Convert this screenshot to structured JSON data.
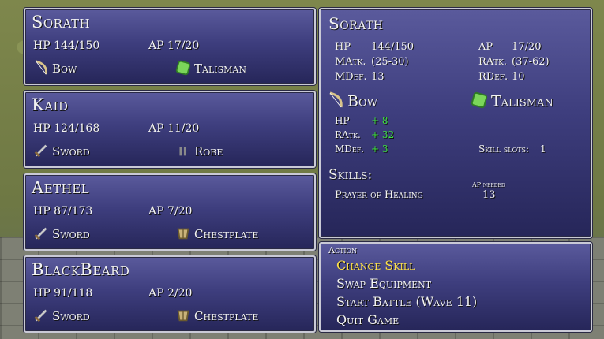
{
  "party": [
    {
      "name": "Sorath",
      "hp": "HP 144/150",
      "ap": "AP 17/20",
      "weapon_icon": "bow-icon",
      "weapon": "Bow",
      "armor_icon": "talisman-icon",
      "armor": "Talisman"
    },
    {
      "name": "Kaid",
      "hp": "HP 124/168",
      "ap": "AP 11/20",
      "weapon_icon": "sword-icon",
      "weapon": "Sword",
      "armor_icon": "robe-icon",
      "armor": "Robe"
    },
    {
      "name": "Aethel",
      "hp": "HP 87/173",
      "ap": "AP 7/20",
      "weapon_icon": "sword-icon",
      "weapon": "Sword",
      "armor_icon": "chestplate-icon",
      "armor": "Chestplate"
    },
    {
      "name": "BlackBeard",
      "hp": "HP 91/118",
      "ap": "AP 2/20",
      "weapon_icon": "sword-icon",
      "weapon": "Sword",
      "armor_icon": "chestplate-icon",
      "armor": "Chestplate"
    }
  ],
  "detail": {
    "name": "Sorath",
    "stats_left": [
      {
        "label": "HP",
        "value": "144/150"
      },
      {
        "label": "MAtk.",
        "value": "(25-30)"
      },
      {
        "label": "MDef.",
        "value": "13"
      }
    ],
    "stats_right": [
      {
        "label": "AP",
        "value": "17/20"
      },
      {
        "label": "RAtk.",
        "value": "(37-62)"
      },
      {
        "label": "RDef.",
        "value": "10"
      }
    ],
    "weapon": "Bow",
    "armor": "Talisman",
    "bonuses": [
      {
        "label": "HP",
        "value": "+ 8"
      },
      {
        "label": "RAtk.",
        "value": "+ 32"
      },
      {
        "label": "MDef.",
        "value": "+ 3"
      }
    ],
    "skill_slots_label": "Skill slots:",
    "skill_slots_value": "1",
    "skills_title": "Skills:",
    "ap_needed_label": "AP needed",
    "skills": [
      {
        "name": "Prayer of Healing",
        "ap": "13"
      }
    ]
  },
  "actions": {
    "title": "Action",
    "items": [
      "Change Skill",
      "Swap Equipment",
      "Start Battle (Wave 11)",
      "Quit Game"
    ],
    "selected_index": 0
  },
  "colors": {
    "panel_top": "#5a5a9c",
    "panel_bottom": "#262659",
    "selected": "#ffe24a",
    "bonus": "#3de03d"
  }
}
